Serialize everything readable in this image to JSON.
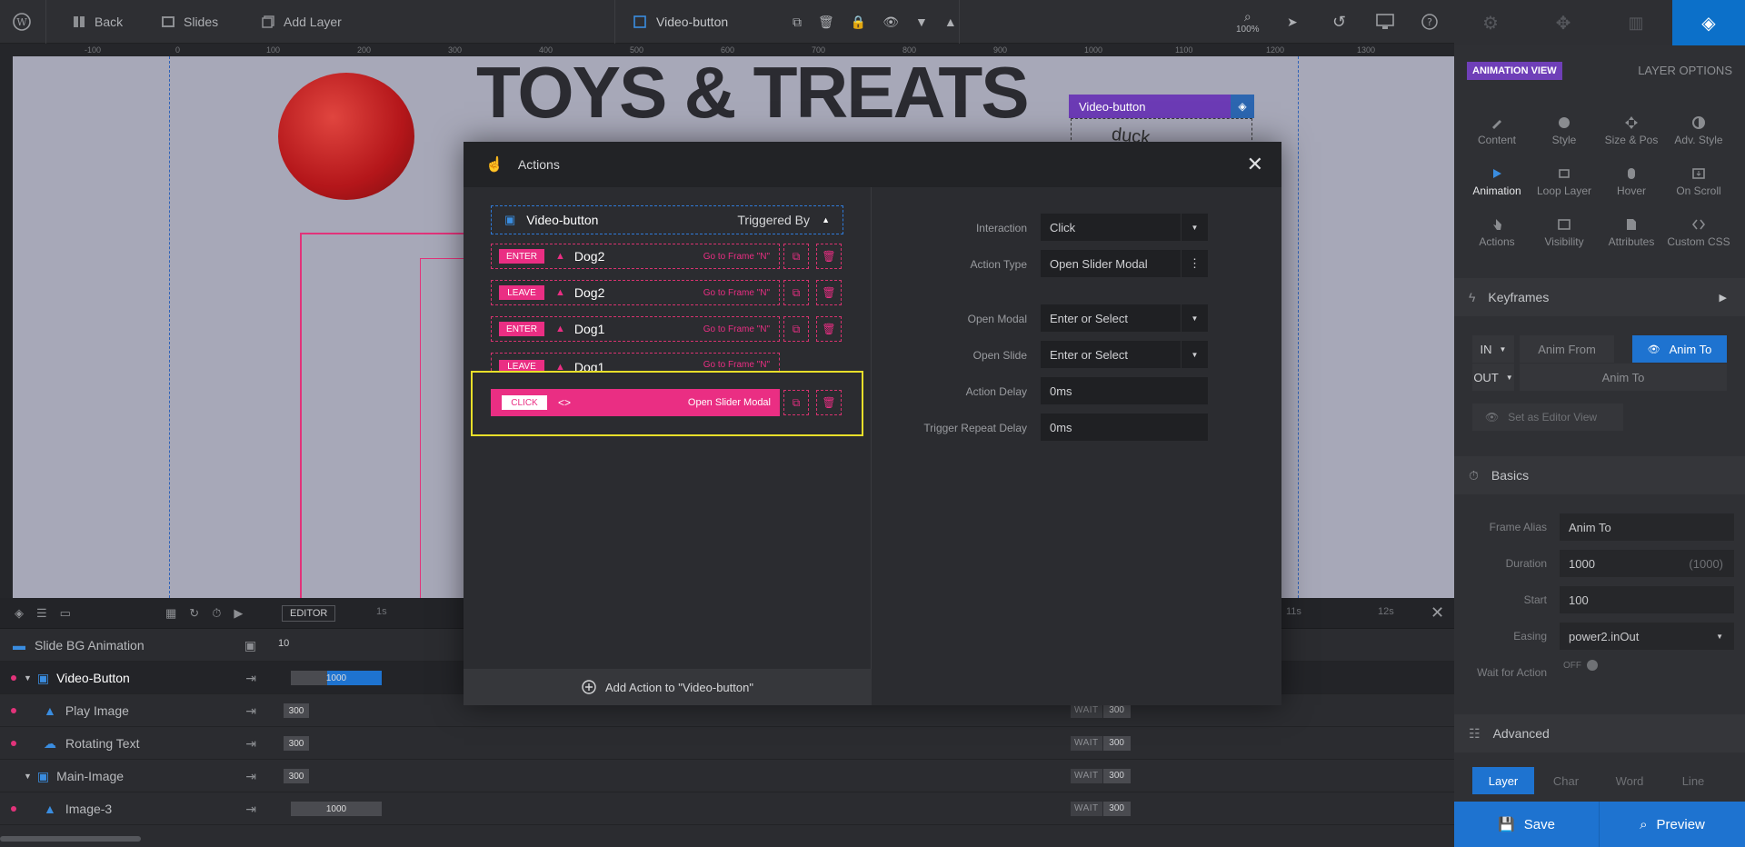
{
  "topbar": {
    "back": "Back",
    "slides": "Slides",
    "add_layer": "Add Layer",
    "layer_name": "Video-button",
    "zoom": "100%"
  },
  "ruler": {
    "ticks": [
      "-100",
      "0",
      "100",
      "200",
      "300",
      "400",
      "500",
      "600",
      "700",
      "800",
      "900",
      "1000",
      "1100",
      "1200",
      "1300"
    ]
  },
  "canvas": {
    "headline": "TOYS & TREATS",
    "vb_tag": "Video-button",
    "vb_text": "duck"
  },
  "modal": {
    "title": "Actions",
    "layer": "Video-button",
    "triggered_by": "Triggered By",
    "rows": [
      {
        "tag": "ENTER",
        "name": "Dog2",
        "desc": "Go to Frame \"N\""
      },
      {
        "tag": "LEAVE",
        "name": "Dog2",
        "desc": "Go to Frame \"N\""
      },
      {
        "tag": "ENTER",
        "name": "Dog1",
        "desc": "Go to Frame \"N\""
      },
      {
        "tag": "LEAVE",
        "name": "Dog1",
        "desc": "Go to Frame \"N\""
      }
    ],
    "click_row": {
      "tag": "CLICK",
      "desc": "Open Slider Modal"
    },
    "add_action": "Add Action to \"Video-button\"",
    "fields": {
      "interaction": {
        "label": "Interaction",
        "value": "Click"
      },
      "action_type": {
        "label": "Action Type",
        "value": "Open Slider Modal"
      },
      "open_modal": {
        "label": "Open Modal",
        "value": "Enter or Select"
      },
      "open_slide": {
        "label": "Open Slide",
        "value": "Enter or Select"
      },
      "action_delay": {
        "label": "Action Delay",
        "value": "0ms"
      },
      "trigger_repeat": {
        "label": "Trigger Repeat Delay",
        "value": "0ms"
      }
    }
  },
  "timeline": {
    "editor": "EDITOR",
    "t1": "1s",
    "t11": "11s",
    "t12": "12s",
    "slide_bg": "Slide BG Animation",
    "slide_bg_val": "10",
    "rows": [
      {
        "name": "Video-Button",
        "bar": "1000"
      },
      {
        "name": "Play Image",
        "bar": "300"
      },
      {
        "name": "Rotating Text",
        "bar": "300"
      },
      {
        "name": "Main-Image",
        "bar": "300"
      },
      {
        "name": "Image-3",
        "bar": "1000"
      }
    ],
    "wait": "WAIT",
    "wait_val": "300"
  },
  "right_panel": {
    "animation_view": "ANIMATION VIEW",
    "layer_options": "LAYER OPTIONS",
    "icons": [
      "Content",
      "Style",
      "Size & Pos",
      "Adv. Style",
      "Animation",
      "Loop Layer",
      "Hover",
      "On Scroll",
      "Actions",
      "Visibility",
      "Attributes",
      "Custom CSS"
    ],
    "keyframes": "Keyframes",
    "in": "IN",
    "out": "OUT",
    "anim_from": "Anim From",
    "anim_to": "Anim To",
    "anim_to2": "Anim To",
    "set_editor_view": "Set as Editor View",
    "basics": "Basics",
    "frame_alias_label": "Frame Alias",
    "frame_alias": "Anim To",
    "duration_label": "Duration",
    "duration": "1000",
    "duration_hint": "(1000)",
    "start_label": "Start",
    "start": "100",
    "easing_label": "Easing",
    "easing": "power2.inOut",
    "wait_label": "Wait for Action",
    "wait_off": "OFF",
    "advanced": "Advanced",
    "split_tabs": [
      "Layer",
      "Char",
      "Word",
      "Line"
    ],
    "save": "Save",
    "preview": "Preview"
  }
}
